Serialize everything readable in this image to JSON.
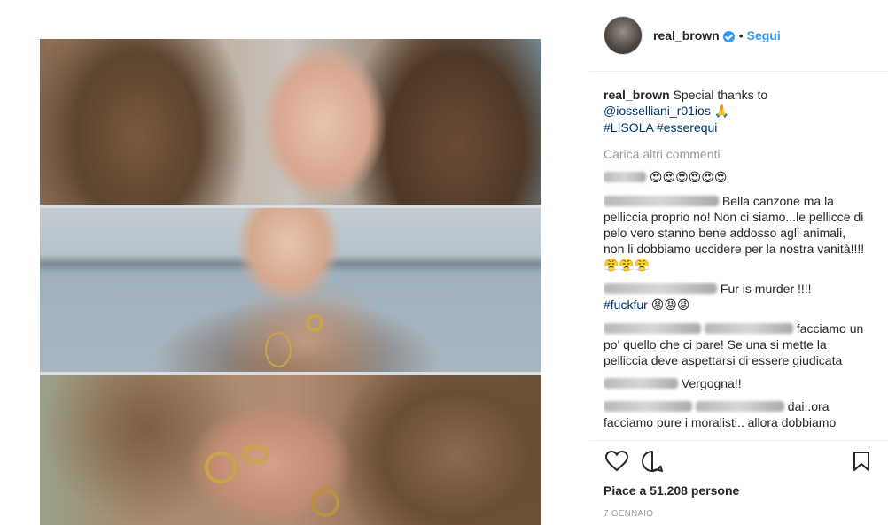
{
  "post": {
    "username": "real_brown",
    "verified": true,
    "follow_label": "Segui",
    "separator": "•",
    "caption": {
      "user": "real_brown",
      "text": "Special thanks to",
      "mention": "@iosselliani_r01ios",
      "emoji": "🙏",
      "hashtags": "#LISOLA #esserequi"
    },
    "load_more": "Carica altri commenti",
    "comments": [
      {
        "user": "",
        "text": "",
        "emoji": "😍😍😍😍😍😍"
      },
      {
        "user": "",
        "text": "Bella canzone ma la pelliccia proprio no! Non ci siamo...le pellicce di pelo vero stanno bene addosso agli animali, non li dobbiamo uccidere per la nostra vanità!!!!",
        "emoji": "😤😤😤"
      },
      {
        "user": "",
        "text": "Fur is murder !!!!",
        "hashtag": "#fuckfur",
        "emoji": "😡😡😡"
      },
      {
        "user": "",
        "mention": "",
        "text": "facciamo un po' quello che ci pare! Se una si mette la pelliccia deve aspettarsi di essere giudicata"
      },
      {
        "user": "",
        "text": "Vergogna!!"
      },
      {
        "user": "",
        "mention": "",
        "text": "dai..ora facciamo pure i moralisti.. allora dobbiamo"
      }
    ],
    "likes": "Piace a 51.208 persone",
    "date": "7 GENNAIO",
    "icons": [
      "heart-icon",
      "comment-icon",
      "bookmark-icon"
    ],
    "colors": {
      "link": "#003569",
      "follow": "#3897f0",
      "muted": "#999999",
      "text": "#262626"
    }
  }
}
